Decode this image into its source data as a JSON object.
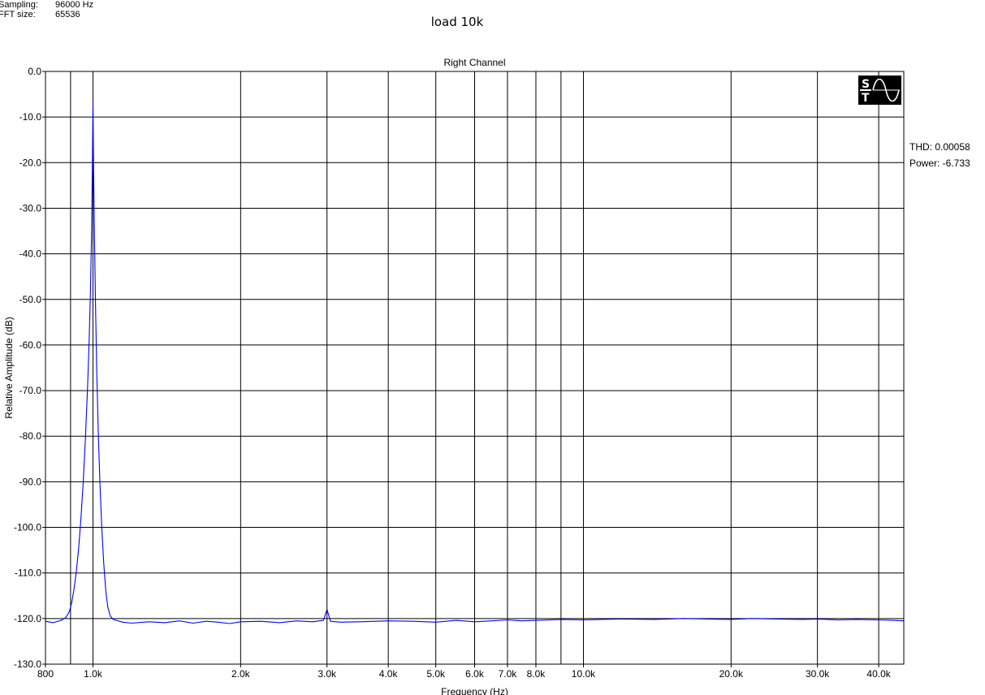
{
  "header": {
    "sampling_label": "Sampling:",
    "sampling_value": "96000 Hz",
    "fft_label": "FFT size:",
    "fft_value": "65536",
    "title": "load 10k"
  },
  "stats": {
    "thd": "THD: 0.00058",
    "power": "Power: -6.733"
  },
  "logo": {
    "letters": "ST",
    "icon": "sine-wave-logo-icon"
  },
  "chart_data": {
    "type": "line",
    "title": "Right Channel",
    "xlabel": "Frequency (Hz)",
    "ylabel": "Relative Amplitude (dB)",
    "x_scale": "log",
    "xlim": [
      800,
      45000
    ],
    "ylim": [
      -130,
      0
    ],
    "grid": true,
    "y_ticks": [
      0,
      -10,
      -20,
      -30,
      -40,
      -50,
      -60,
      -70,
      -80,
      -90,
      -100,
      -110,
      -120,
      -130
    ],
    "y_tick_labels": [
      "0.0",
      "-10.0",
      "-20.0",
      "-30.0",
      "-40.0",
      "-50.0",
      "-60.0",
      "-70.0",
      "-80.0",
      "-90.0",
      "-100.0",
      "-110.0",
      "-120.0",
      "-130.0"
    ],
    "x_ticks": [
      800,
      1000,
      2000,
      3000,
      4000,
      5000,
      6000,
      7000,
      8000,
      10000,
      20000,
      30000,
      40000
    ],
    "x_tick_labels": [
      "800",
      "1.0k",
      "2.0k",
      "3.0k",
      "4.0k",
      "5.0k",
      "6.0k",
      "7.0k",
      "8.0k",
      "10.0k",
      "20.0k",
      "30.0k",
      "40.0k"
    ],
    "x_gridlines": [
      900,
      1000,
      2000,
      3000,
      4000,
      5000,
      6000,
      7000,
      8000,
      9000,
      10000,
      20000,
      30000,
      40000
    ],
    "series": [
      {
        "color": "#0000ff",
        "x": [
          800,
          830,
          860,
          880,
          895,
          905,
          915,
          925,
          935,
          945,
          955,
          965,
          975,
          982,
          988,
          993,
          997,
          1000,
          1003,
          1007,
          1012,
          1018,
          1025,
          1033,
          1042,
          1052,
          1062,
          1072,
          1085,
          1100,
          1150,
          1200,
          1300,
          1400,
          1500,
          1600,
          1700,
          1800,
          1900,
          2000,
          2200,
          2400,
          2600,
          2800,
          2950,
          3000,
          3050,
          3200,
          3500,
          4000,
          4500,
          5000,
          5500,
          6000,
          6500,
          7000,
          7500,
          8000,
          9000,
          10000,
          12000,
          14000,
          16000,
          18000,
          20000,
          22000,
          25000,
          28000,
          30000,
          33000,
          36000,
          40000,
          43000,
          45000
        ],
        "y": [
          -120.6,
          -120.9,
          -120.4,
          -119.8,
          -118.5,
          -116.5,
          -113.5,
          -109.5,
          -104.5,
          -98.0,
          -90.0,
          -80.5,
          -69.0,
          -59.0,
          -48.0,
          -36.0,
          -22.0,
          -7.0,
          -22.0,
          -37.0,
          -52.0,
          -66.0,
          -79.0,
          -90.0,
          -100.0,
          -108.0,
          -114.0,
          -117.5,
          -119.5,
          -120.2,
          -120.8,
          -121.0,
          -120.7,
          -120.9,
          -120.5,
          -121.0,
          -120.6,
          -120.8,
          -121.1,
          -120.7,
          -120.6,
          -120.9,
          -120.5,
          -120.7,
          -120.4,
          -118.0,
          -120.6,
          -120.8,
          -120.7,
          -120.5,
          -120.6,
          -120.8,
          -120.4,
          -120.7,
          -120.5,
          -120.3,
          -120.5,
          -120.4,
          -120.2,
          -120.3,
          -120.1,
          -120.2,
          -120.0,
          -120.1,
          -120.2,
          -120.0,
          -120.1,
          -120.2,
          -120.1,
          -120.3,
          -120.2,
          -120.3,
          -120.4,
          -120.5
        ]
      }
    ]
  }
}
